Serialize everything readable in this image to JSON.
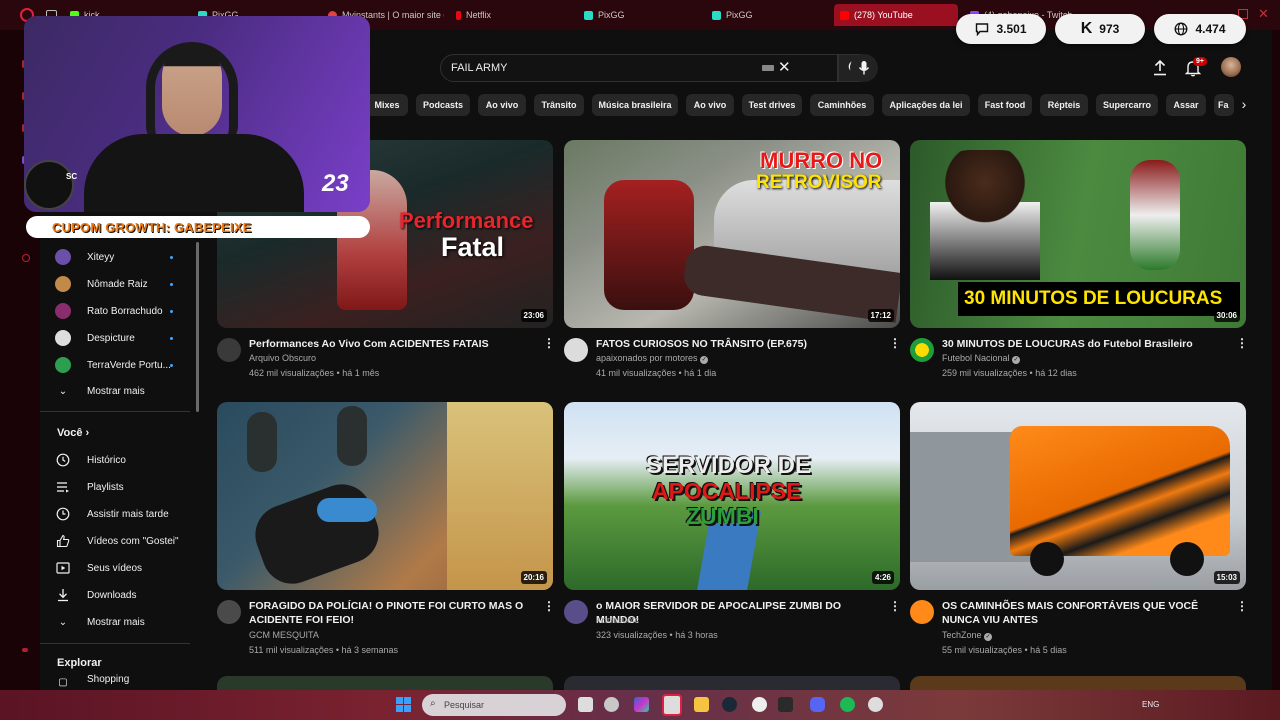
{
  "browser": {
    "tabs": [
      {
        "label": "kick",
        "color": "#53fc18"
      },
      {
        "label": "PixGG",
        "color": "#2bd9c6"
      },
      {
        "label": "Myinstants | O maior site d",
        "color": "#e83f3f"
      },
      {
        "label": "Netflix",
        "color": "#e50914"
      },
      {
        "label": "PixGG",
        "color": "#2bd9c6"
      },
      {
        "label": "PixGG",
        "color": "#2bd9c6"
      },
      {
        "label": "(278) YouTube",
        "color": "#ff0000"
      },
      {
        "label": "(4) gabepeixe - Twitch",
        "color": "#9146ff"
      }
    ]
  },
  "stats": [
    {
      "icon": "chat-bubble-icon",
      "value": "3.501"
    },
    {
      "icon": "kick-k-icon",
      "value": "973"
    },
    {
      "icon": "globe-icon",
      "value": "4.474"
    }
  ],
  "header": {
    "search_value": "FAIL ARMY",
    "notification_count": "9+"
  },
  "chips": [
    "Mixes",
    "Podcasts",
    "Ao vivo",
    "Trânsito",
    "Música brasileira",
    "Ao vivo",
    "Test drives",
    "Caminhões",
    "Aplicações da lei",
    "Fast food",
    "Répteis",
    "Supercarro",
    "Assar",
    "Fa"
  ],
  "webcam": {
    "badge": "23",
    "banner": "CUPOM GROWTH: GABEPEIXE",
    "side_label": "SC"
  },
  "sidebar": {
    "subscriptions": [
      {
        "label": "Xiteyy",
        "color": "#6b4fa8"
      },
      {
        "label": "Nômade Raiz",
        "color": "#c28a4a"
      },
      {
        "label": "Rato Borrachudo",
        "color": "#8a2d6f"
      },
      {
        "label": "Despicture",
        "color": "#dddddd"
      },
      {
        "label": "TerraVerde Portu...",
        "color": "#2d9e4f"
      }
    ],
    "show_more": "Mostrar mais",
    "you_section": "Você",
    "you_items": [
      {
        "label": "Histórico",
        "icon": "history-icon"
      },
      {
        "label": "Playlists",
        "icon": "playlist-icon"
      },
      {
        "label": "Assistir mais tarde",
        "icon": "clock-icon"
      },
      {
        "label": "Vídeos com \"Gostei\"",
        "icon": "thumbs-up-icon"
      },
      {
        "label": "Seus vídeos",
        "icon": "play-square-icon"
      },
      {
        "label": "Downloads",
        "icon": "download-icon"
      }
    ],
    "show_more_2": "Mostrar mais",
    "explore": "Explorar",
    "shopping": "Shopping"
  },
  "videos": [
    {
      "title": "Performances Ao Vivo Com ACIDENTES FATAIS",
      "channel": "Arquivo Obscuro",
      "verified": false,
      "meta": "462 mil visualizações • há 1 mês",
      "duration": "23:06",
      "thumb_text": [
        "Performance",
        "Fatal"
      ]
    },
    {
      "title": "FATOS CURIOSOS NO TRÂNSITO (EP.675)",
      "channel": "apaixonados por motores",
      "verified": true,
      "meta": "41 mil visualizações • há 1 dia",
      "duration": "17:12",
      "thumb_text": [
        "MURRO NO",
        "RETROVISOR"
      ]
    },
    {
      "title": "30 MINUTOS DE LOUCURAS do Futebol Brasileiro",
      "channel": "Futebol Nacional",
      "verified": true,
      "meta": "259 mil visualizações • há 12 dias",
      "duration": "30:06",
      "thumb_text": [
        "30 MINUTOS DE LOUCURAS"
      ]
    },
    {
      "title": "FORAGIDO DA POLÍCIA! O PINOTE FOI CURTO MAS O ACIDENTE FOI FEIO!",
      "channel": "GCM MESQUITA",
      "verified": false,
      "meta": "511 mil visualizações • há 3 semanas",
      "duration": "20:16",
      "thumb_text": []
    },
    {
      "title": "o MAIOR SERVIDOR DE APOCALIPSE ZUMBI DO MUNDO!",
      "channel": "kzinhuuofc",
      "verified": false,
      "meta": "323 visualizações • há 3 horas",
      "duration": "4:26",
      "thumb_text": [
        "SERVIDOR DE",
        "APOCALIPSE",
        "ZUMBI"
      ]
    },
    {
      "title": "OS CAMINHÕES MAIS CONFORTÁVEIS QUE VOCÊ NUNCA VIU ANTES",
      "channel": "TechZone",
      "verified": true,
      "meta": "55 mil visualizações • há 5 dias",
      "duration": "15:03",
      "thumb_text": []
    }
  ],
  "taskbar": {
    "search_placeholder": "Pesquisar",
    "lang": "ENG"
  }
}
